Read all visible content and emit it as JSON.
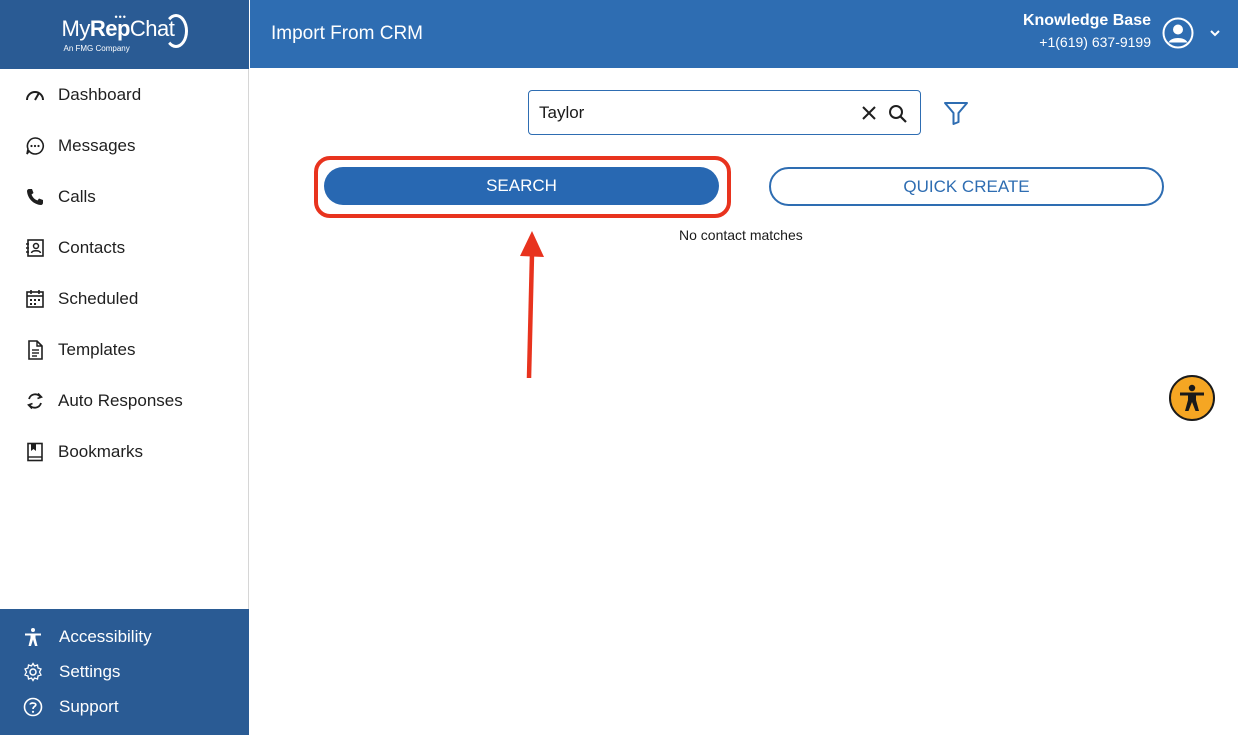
{
  "brand": {
    "logo_main_light": "My",
    "logo_main_bold": "Rep",
    "logo_main_end": "Chat",
    "logo_sub": "An FMG Company",
    "logo_dots": "•••"
  },
  "sidebar": {
    "items": [
      {
        "label": "Dashboard",
        "icon": "speedometer-icon"
      },
      {
        "label": "Messages",
        "icon": "chat-bubble-icon"
      },
      {
        "label": "Calls",
        "icon": "phone-icon"
      },
      {
        "label": "Contacts",
        "icon": "contact-card-icon"
      },
      {
        "label": "Scheduled",
        "icon": "calendar-icon"
      },
      {
        "label": "Templates",
        "icon": "document-icon"
      },
      {
        "label": "Auto Responses",
        "icon": "refresh-icon"
      },
      {
        "label": "Bookmarks",
        "icon": "bookmark-icon"
      }
    ],
    "bottom_items": [
      {
        "label": "Accessibility",
        "icon": "accessibility-icon"
      },
      {
        "label": "Settings",
        "icon": "gear-icon"
      },
      {
        "label": "Support",
        "icon": "help-icon"
      }
    ]
  },
  "header": {
    "title": "Import From CRM",
    "user_name": "Knowledge Base",
    "user_phone": "+1(619) 637-9199"
  },
  "search": {
    "value": "Taylor"
  },
  "actions": {
    "search_label": "SEARCH",
    "quick_create_label": "QUICK CREATE"
  },
  "results": {
    "empty_message": "No contact matches"
  },
  "colors": {
    "primary": "#2e6db2",
    "sidebar_dark": "#2a5b94",
    "annotation": "#e8331e",
    "accessibility_fab": "#f5a623"
  }
}
